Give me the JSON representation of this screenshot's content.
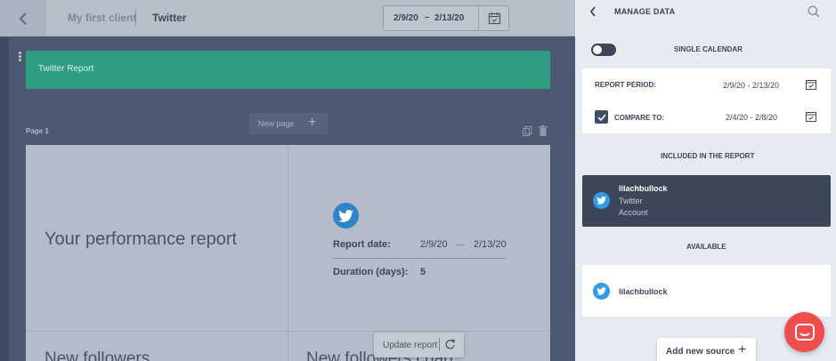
{
  "topbar": {
    "client": "My first client",
    "current": "Twitter",
    "date_from": "2/9/20",
    "date_dash": "–",
    "date_to": "2/13/20"
  },
  "canvas": {
    "banner_title": "Twitter Report",
    "new_page_label": "New page",
    "page_label": "Page 1",
    "performance_title": "Your performance report",
    "report_date_label": "Report date:",
    "report_date_from": "2/9/20",
    "report_date_to": "2/13/20",
    "duration_label": "Duration (days):",
    "duration_value": "5",
    "bottom_title_left": "New followers",
    "bottom_title_right": "New followers chart",
    "update_label": "Update report"
  },
  "panel": {
    "title": "MANAGE DATA",
    "single_calendar": "SINGLE CALENDAR",
    "single_calendar_on": false,
    "report_period_label": "REPORT PERIOD:",
    "report_period_value": "2/9/20 - 2/13/20",
    "compare_label": "COMPARE TO:",
    "compare_checked": true,
    "compare_value": "2/4/20 - 2/8/20",
    "included_title": "INCLUDED IN THE REPORT",
    "included": {
      "name": "lilachbullock",
      "platform": "Twitter",
      "type": "Account"
    },
    "available_title": "AVAILABLE",
    "available": {
      "name": "lilachbullock"
    },
    "add_source_label": "Add new source"
  },
  "icons": {
    "back": "chevron-left-icon",
    "calendar": "calendar-icon",
    "search": "search-icon",
    "twitter": "twitter-icon",
    "chat": "chat-icon",
    "copy": "copy-icon",
    "trash": "trash-icon",
    "refresh": "refresh-icon"
  },
  "colors": {
    "banner": "#2e9e83",
    "twitter_blue": "#2d9be6",
    "chat_red": "#f04d4d",
    "selected_card": "#3d4658"
  }
}
